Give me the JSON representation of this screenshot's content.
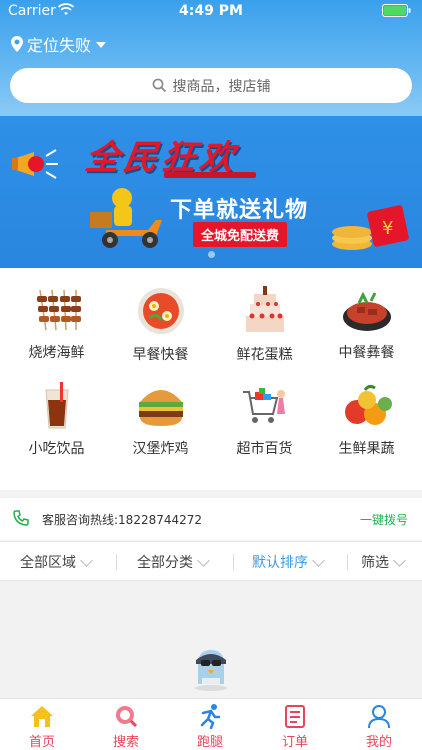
{
  "status": {
    "carrier": "Carrier",
    "time": "4:49 PM"
  },
  "header": {
    "location": "定位失败",
    "search_placeholder": "搜商品，搜店铺"
  },
  "banner": {
    "title": "全民狂欢",
    "subtitle": "下单就送礼物",
    "pill": "全城免配送费"
  },
  "categories": [
    {
      "label": "烧烤海鲜",
      "icon": "bbq-skewers-icon"
    },
    {
      "label": "早餐快餐",
      "icon": "breakfast-bowl-icon"
    },
    {
      "label": "鲜花蛋糕",
      "icon": "cake-icon"
    },
    {
      "label": "中餐彝餐",
      "icon": "chinese-dish-icon"
    },
    {
      "label": "小吃饮品",
      "icon": "drink-icon"
    },
    {
      "label": "汉堡炸鸡",
      "icon": "burger-icon"
    },
    {
      "label": "超市百货",
      "icon": "shopping-cart-icon"
    },
    {
      "label": "生鲜果蔬",
      "icon": "fruit-icon"
    }
  ],
  "hotline": {
    "text": "客服咨询热线:18228744272",
    "action": "一键拨号"
  },
  "filters": {
    "area": "全部区域",
    "category": "全部分类",
    "sort": "默认排序",
    "filter": "筛选"
  },
  "tabs": [
    {
      "label": "首页",
      "icon": "home-icon"
    },
    {
      "label": "搜索",
      "icon": "search-icon"
    },
    {
      "label": "跑腿",
      "icon": "runner-icon"
    },
    {
      "label": "订单",
      "icon": "order-icon"
    },
    {
      "label": "我的",
      "icon": "profile-icon"
    }
  ],
  "colors": {
    "primary": "#3aa0ec",
    "accent": "#e9445c",
    "call": "#22b14c",
    "sort_active": "#3aa0ec"
  }
}
